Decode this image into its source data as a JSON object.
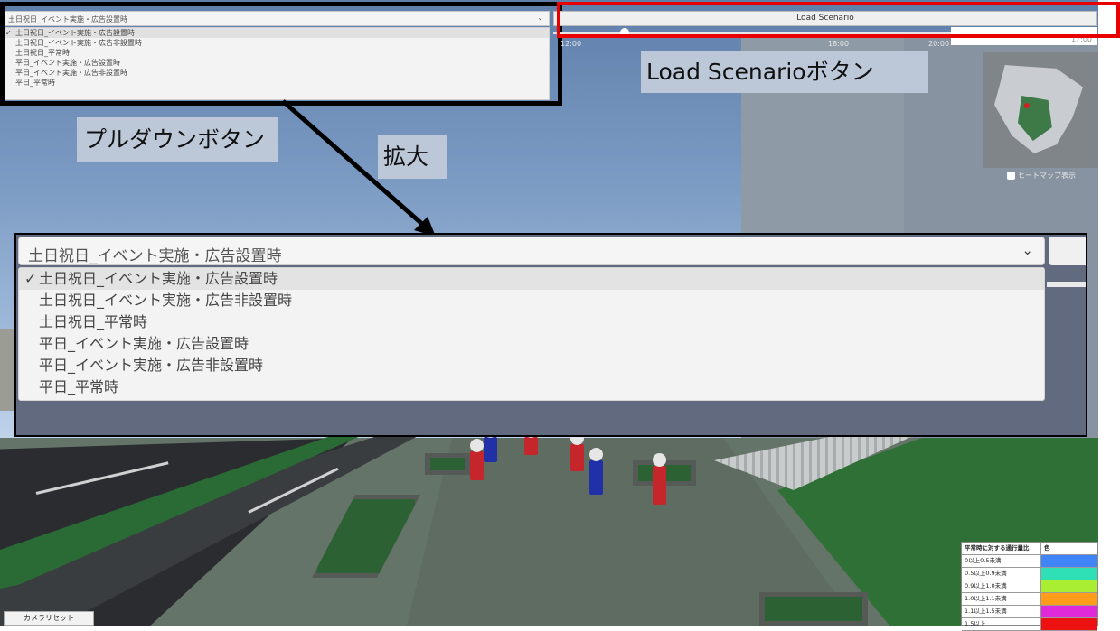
{
  "dropdown": {
    "selected": "土日祝日_イベント実施・広告設置時",
    "chevron_icon": "chevron-down-icon",
    "check_icon": "checkmark-icon",
    "options": [
      "土日祝日_イベント実施・広告設置時",
      "土日祝日_イベント実施・広告非設置時",
      "土日祝日_平常時",
      "平日_イベント実施・広告設置時",
      "平日_イベント実施・広告非設置時",
      "平日_平常時"
    ]
  },
  "load_button": {
    "label": "Load Scenario"
  },
  "timeline": {
    "ticks": [
      "12:00",
      "18:00",
      "20:00"
    ],
    "value": "17:00"
  },
  "minimap": {
    "heatmap_label": "ヒートマップ表示"
  },
  "captions": {
    "load": "Load Scenarioボタン",
    "pulldown": "プルダウンボタン",
    "zoom": "拡大"
  },
  "legend": {
    "header": [
      "平常時に対する通行量比",
      "色"
    ],
    "rows": [
      {
        "label": "0以上0.5未満",
        "color": "#3f85f7"
      },
      {
        "label": "0.5以上0.9未満",
        "color": "#2fe0b7"
      },
      {
        "label": "0.9以上1.0未満",
        "color": "#aaee33"
      },
      {
        "label": "1.0以上1.1未満",
        "color": "#ff9c1a"
      },
      {
        "label": "1.1以上1.5未満",
        "color": "#e029d9"
      },
      {
        "label": "1.5以上",
        "color": "#ee1111"
      }
    ]
  },
  "camera_reset": {
    "label": "カメラリセット"
  },
  "colors": {
    "highlight_red": "#e80000",
    "caption_bg": "#bcc8d8"
  }
}
